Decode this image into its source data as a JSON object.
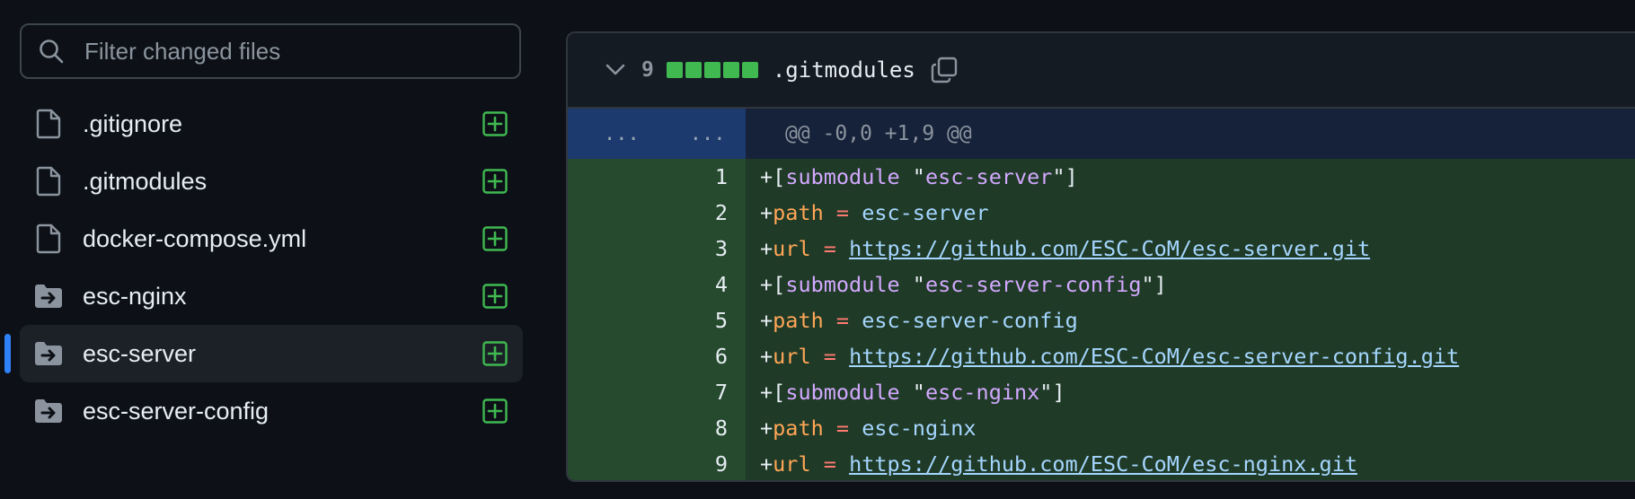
{
  "search": {
    "placeholder": "Filter changed files"
  },
  "files": [
    {
      "name": ".gitignore",
      "type": "file",
      "status": "added"
    },
    {
      "name": ".gitmodules",
      "type": "file",
      "status": "added"
    },
    {
      "name": "docker-compose.yml",
      "type": "file",
      "status": "added"
    },
    {
      "name": "esc-nginx",
      "type": "submodule",
      "status": "added"
    },
    {
      "name": "esc-server",
      "type": "submodule",
      "status": "added",
      "active": true
    },
    {
      "name": "esc-server-config",
      "type": "submodule",
      "status": "added"
    }
  ],
  "diff": {
    "changes": "9",
    "filename": ".gitmodules",
    "hunk_old": "...",
    "hunk_new": "...",
    "hunk_header": "@@ -0,0 +1,9 @@",
    "lines": [
      {
        "num": "1",
        "sign": "+",
        "indent": "",
        "key": "submodule",
        "sep": " ",
        "value": "esc-server",
        "kind": "section"
      },
      {
        "num": "2",
        "sign": "+",
        "indent": "        ",
        "key": "path",
        "sep": " = ",
        "value": "esc-server",
        "kind": "plain"
      },
      {
        "num": "3",
        "sign": "+",
        "indent": "        ",
        "key": "url",
        "sep": " = ",
        "value": "https://github.com/ESC-CoM/esc-server.git",
        "kind": "link"
      },
      {
        "num": "4",
        "sign": "+",
        "indent": "",
        "key": "submodule",
        "sep": " ",
        "value": "esc-server-config",
        "kind": "section"
      },
      {
        "num": "5",
        "sign": "+",
        "indent": "        ",
        "key": "path",
        "sep": " = ",
        "value": "esc-server-config",
        "kind": "plain"
      },
      {
        "num": "6",
        "sign": "+",
        "indent": "        ",
        "key": "url",
        "sep": " = ",
        "value": "https://github.com/ESC-CoM/esc-server-config.git",
        "kind": "link"
      },
      {
        "num": "7",
        "sign": "+",
        "indent": "",
        "key": "submodule",
        "sep": " ",
        "value": "esc-nginx",
        "kind": "section"
      },
      {
        "num": "8",
        "sign": "+",
        "indent": "        ",
        "key": "path",
        "sep": " = ",
        "value": "esc-nginx",
        "kind": "plain"
      },
      {
        "num": "9",
        "sign": "+",
        "indent": "        ",
        "key": "url",
        "sep": " = ",
        "value": "https://github.com/ESC-CoM/esc-nginx.git",
        "kind": "link"
      }
    ]
  },
  "colors": {
    "added": "#3fb950",
    "accent": "#2f81f7",
    "background": "#0d1117"
  }
}
